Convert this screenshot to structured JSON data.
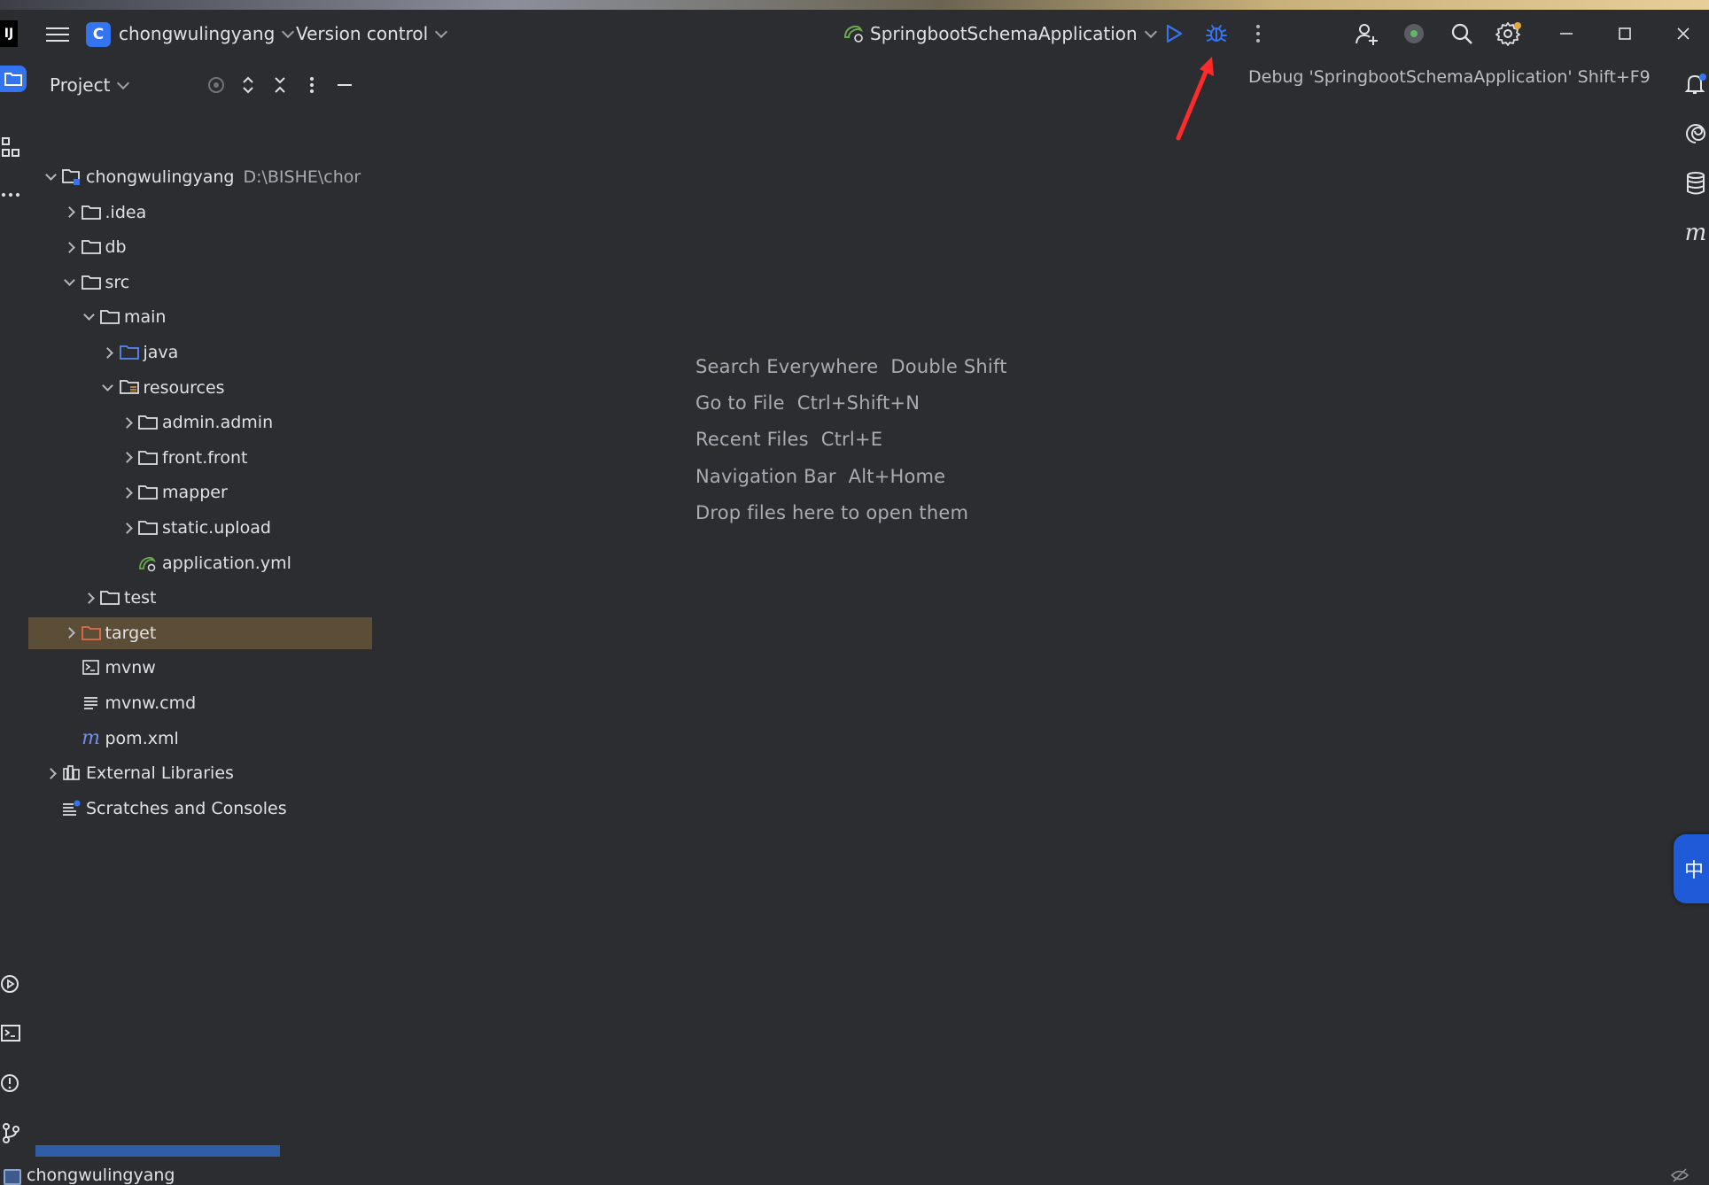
{
  "titlebar": {
    "ide_logo": "IJ",
    "project_badge": "C",
    "project_name": "chongwulingyang",
    "vcs_label": "Version control",
    "run_config": "SpringbootSchemaApplication",
    "debug_tooltip": "Debug 'SpringbootSchemaApplication'  Shift+F9"
  },
  "project_panel": {
    "title": "Project",
    "tree": [
      {
        "label": "chongwulingyang",
        "path": "D:\\BISHE\\chor",
        "depth": 0,
        "expanded": true,
        "icon": "module-folder-icon"
      },
      {
        "label": ".idea",
        "depth": 1,
        "expanded": false,
        "icon": "folder-icon"
      },
      {
        "label": "db",
        "depth": 1,
        "expanded": false,
        "icon": "folder-icon"
      },
      {
        "label": "src",
        "depth": 1,
        "expanded": true,
        "icon": "folder-icon"
      },
      {
        "label": "main",
        "depth": 2,
        "expanded": true,
        "icon": "folder-icon"
      },
      {
        "label": "java",
        "depth": 3,
        "expanded": false,
        "icon": "source-folder-icon"
      },
      {
        "label": "resources",
        "depth": 3,
        "expanded": true,
        "icon": "resources-folder-icon"
      },
      {
        "label": "admin.admin",
        "depth": 4,
        "expanded": false,
        "icon": "folder-icon"
      },
      {
        "label": "front.front",
        "depth": 4,
        "expanded": false,
        "icon": "folder-icon"
      },
      {
        "label": "mapper",
        "depth": 4,
        "expanded": false,
        "icon": "folder-icon"
      },
      {
        "label": "static.upload",
        "depth": 4,
        "expanded": false,
        "icon": "folder-icon"
      },
      {
        "label": "application.yml",
        "depth": 4,
        "expanded": null,
        "icon": "spring-config-icon"
      },
      {
        "label": "test",
        "depth": 2,
        "expanded": false,
        "icon": "folder-icon"
      },
      {
        "label": "target",
        "depth": 1,
        "expanded": false,
        "icon": "excluded-folder-icon",
        "selected": true
      },
      {
        "label": "mvnw",
        "depth": 1,
        "expanded": null,
        "icon": "shell-script-icon"
      },
      {
        "label": "mvnw.cmd",
        "depth": 1,
        "expanded": null,
        "icon": "text-file-icon"
      },
      {
        "label": "pom.xml",
        "depth": 1,
        "expanded": null,
        "icon": "maven-icon"
      },
      {
        "label": "External Libraries",
        "depth": 0,
        "expanded": false,
        "icon": "libraries-icon"
      },
      {
        "label": "Scratches and Consoles",
        "depth": 0,
        "expanded": null,
        "icon": "scratches-icon"
      }
    ]
  },
  "editor_hints": [
    {
      "action": "Search Everywhere",
      "shortcut": "Double Shift"
    },
    {
      "action": "Go to File",
      "shortcut": "Ctrl+Shift+N"
    },
    {
      "action": "Recent Files",
      "shortcut": "Ctrl+E"
    },
    {
      "action": "Navigation Bar",
      "shortcut": "Alt+Home"
    },
    {
      "action": "Drop files here to open them",
      "shortcut": ""
    }
  ],
  "statusbar": {
    "project": "chongwulingyang"
  },
  "ime_indicator": "中",
  "colors": {
    "background": "#2b2d30",
    "accent": "#3574f0",
    "selection": "#5c4d36",
    "annotation_arrow": "#ff2a2a"
  }
}
